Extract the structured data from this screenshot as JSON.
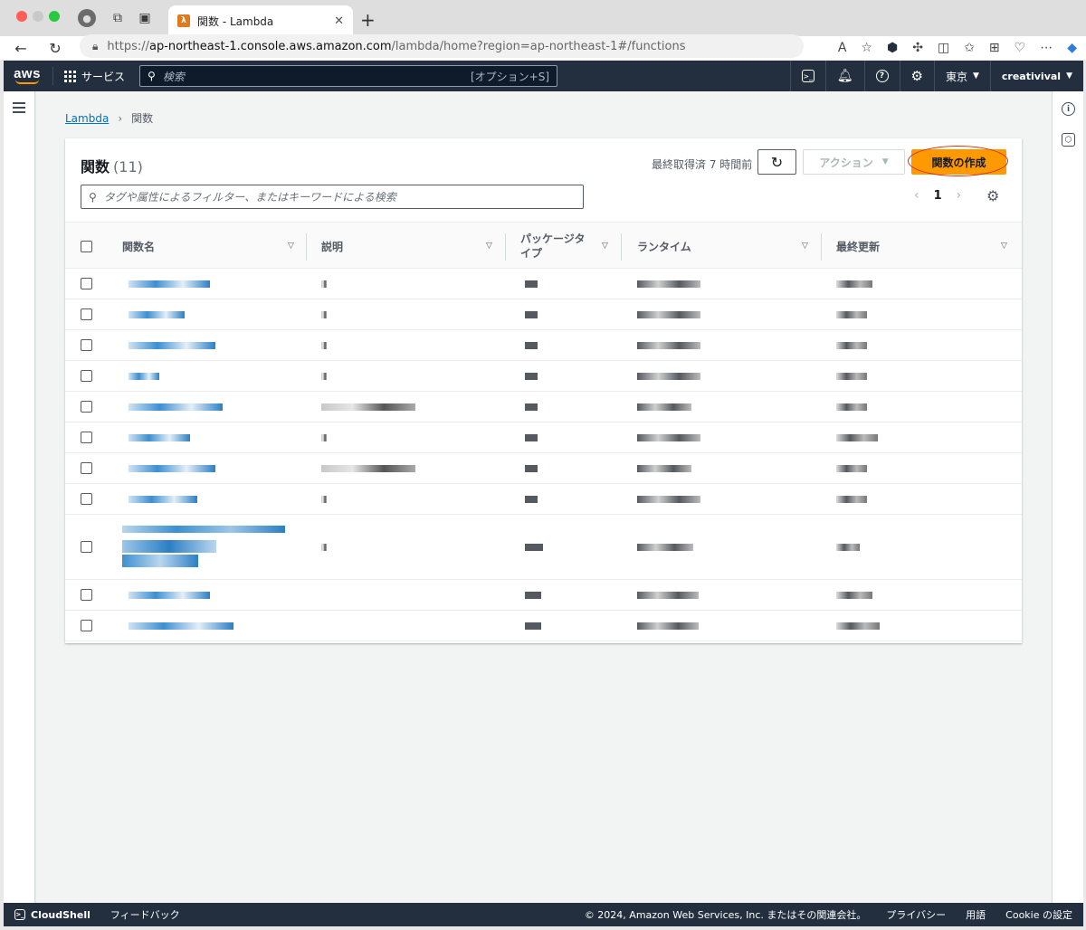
{
  "browser": {
    "tab_title": "関数 - Lambda",
    "url_scheme": "https://",
    "url_host": "ap-northeast-1.console.aws.amazon.com",
    "url_path": "/lambda/home?region=ap-northeast-1#/functions"
  },
  "aws_nav": {
    "logo": "aws",
    "services_label": "サービス",
    "search_placeholder": "検索",
    "search_shortcut": "[オプション+S]",
    "region": "東京",
    "account": "creativival"
  },
  "breadcrumb": {
    "root": "Lambda",
    "current": "関数"
  },
  "functions_panel": {
    "title": "関数",
    "count": "(11)",
    "last_fetched": "最終取得済 7 時間前",
    "action_label": "アクション",
    "create_label": "関数の作成",
    "filter_placeholder": "タグや属性によるフィルター、またはキーワードによる検索",
    "page_number": "1",
    "columns": {
      "name": "関数名",
      "description": "説明",
      "package_type": "パッケージタイプ",
      "runtime": "ランタイム",
      "last_modified": "最終更新"
    }
  },
  "footer": {
    "cloudshell": "CloudShell",
    "feedback": "フィードバック",
    "copyright": "© 2024, Amazon Web Services, Inc. またはその関連会社。",
    "privacy": "プライバシー",
    "terms": "用語",
    "cookie": "Cookie の設定"
  },
  "colors": {
    "aws_nav_bg": "#232f3e",
    "primary_button": "#ff9900",
    "link": "#0073bb",
    "highlight_ring": "#d13212"
  }
}
